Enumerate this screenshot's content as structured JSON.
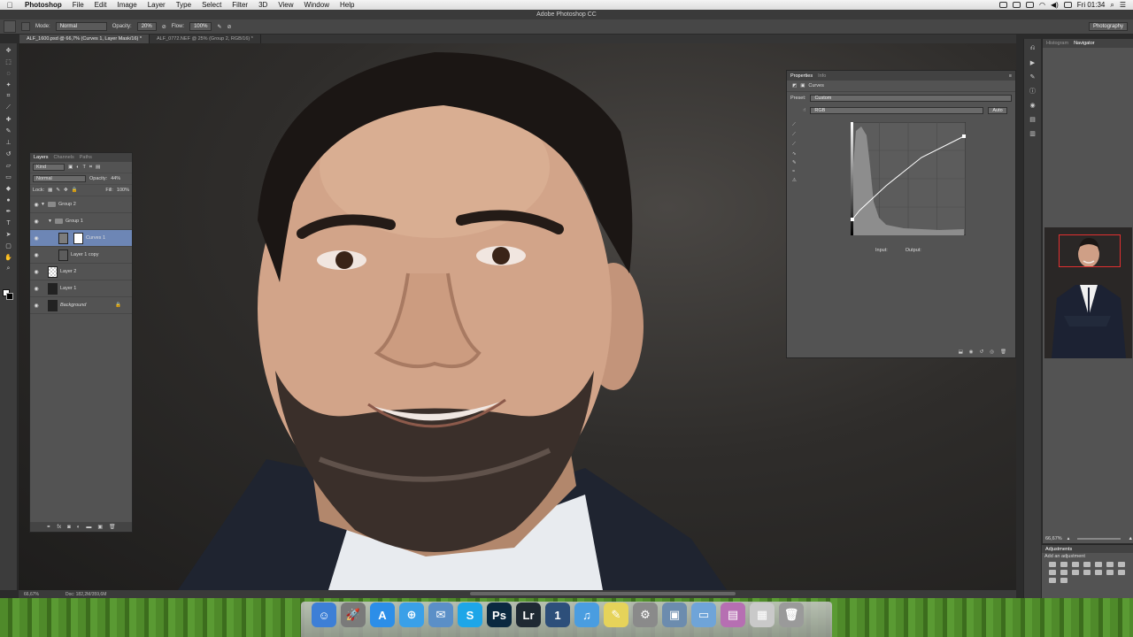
{
  "menubar": {
    "app": "Photoshop",
    "items": [
      "File",
      "Edit",
      "Image",
      "Layer",
      "Type",
      "Select",
      "Filter",
      "3D",
      "View",
      "Window",
      "Help"
    ],
    "clock": "Fri 01:34"
  },
  "window": {
    "title": "Adobe Photoshop CC"
  },
  "options": {
    "mode_label": "Mode:",
    "mode_value": "Normal",
    "opacity_label": "Opacity:",
    "opacity_value": "20%",
    "flow_label": "Flow:",
    "flow_value": "100%",
    "workspace": "Photography"
  },
  "doc_tabs": [
    {
      "label": "ALF_1600.psd @ 66,7% (Curves 1, Layer Mask/16) *",
      "active": true
    },
    {
      "label": "ALF_0772.NEF @ 25% (Group 2, RGB/16) *",
      "active": false
    }
  ],
  "layers_panel": {
    "tabs": [
      "Layers",
      "Channels",
      "Paths"
    ],
    "kind": "Kind",
    "blend_mode": "Normal",
    "opacity_label": "Opacity:",
    "opacity": "44%",
    "lock_label": "Lock:",
    "fill_label": "Fill:",
    "fill": "100%",
    "layers": [
      {
        "name": "Group 2",
        "type": "group",
        "indent": 0
      },
      {
        "name": "Group 1",
        "type": "group",
        "indent": 1
      },
      {
        "name": "Curves 1",
        "type": "adjustment",
        "indent": 2,
        "selected": true
      },
      {
        "name": "Layer 1 copy",
        "type": "pixel",
        "indent": 2
      },
      {
        "name": "Layer 2",
        "type": "pixel",
        "indent": 0
      },
      {
        "name": "Layer 1",
        "type": "pixel",
        "indent": 0
      },
      {
        "name": "Background",
        "type": "background",
        "indent": 0,
        "locked": true
      }
    ]
  },
  "properties_panel": {
    "tabs": [
      "Properties",
      "Info"
    ],
    "title": "Curves",
    "preset_label": "Preset:",
    "preset": "Custom",
    "channel": "RGB",
    "auto_label": "Auto",
    "input_label": "Input:",
    "output_label": "Output:"
  },
  "navigator_panel": {
    "tabs": [
      "Histogram",
      "Navigator"
    ],
    "zoom": "66,67%"
  },
  "adjustments_panel": {
    "title": "Adjustments",
    "subtitle": "Add an adjustment"
  },
  "status": {
    "zoom": "66,67%",
    "doc": "Doc: 182,2M/359,6M"
  },
  "dock": {
    "items": [
      {
        "name": "finder",
        "glyph": "☺",
        "color": "#3d7fd6"
      },
      {
        "name": "launchpad",
        "glyph": "🚀",
        "color": "#7a7a7a"
      },
      {
        "name": "app-store",
        "glyph": "A",
        "color": "#2c8ee8"
      },
      {
        "name": "safari",
        "glyph": "⊕",
        "color": "#3aa0e8"
      },
      {
        "name": "mail",
        "glyph": "✉",
        "color": "#5b8fc7"
      },
      {
        "name": "skype",
        "glyph": "S",
        "color": "#1ea6e8"
      },
      {
        "name": "photoshop",
        "glyph": "Ps",
        "color": "#0b2940"
      },
      {
        "name": "lightroom",
        "glyph": "Lr",
        "color": "#1f2a33"
      },
      {
        "name": "1password",
        "glyph": "1",
        "color": "#2d4f7a"
      },
      {
        "name": "itunes",
        "glyph": "♫",
        "color": "#4a9de0"
      },
      {
        "name": "notes",
        "glyph": "✎",
        "color": "#e6d35a"
      },
      {
        "name": "system-preferences",
        "glyph": "⚙",
        "color": "#8a8a8a"
      },
      {
        "name": "preview",
        "glyph": "▣",
        "color": "#6c8cae"
      },
      {
        "name": "folder",
        "glyph": "▭",
        "color": "#6fa4d8"
      },
      {
        "name": "archive",
        "glyph": "▤",
        "color": "#b66fb2"
      },
      {
        "name": "documents",
        "glyph": "▦",
        "color": "#c9c9c9"
      },
      {
        "name": "trash",
        "glyph": "🗑",
        "color": "#9a9a9a"
      }
    ]
  }
}
